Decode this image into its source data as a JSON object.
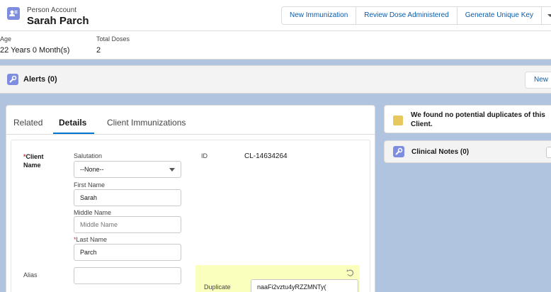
{
  "header": {
    "object_type": "Person Account",
    "record_name": "Sarah Parch",
    "actions": [
      "New Immunization",
      "Review Dose Administered",
      "Generate Unique Key"
    ],
    "more_icon": "chevron-down-icon"
  },
  "highlights": [
    {
      "label": "Age",
      "value": "22 Years 0 Month(s)"
    },
    {
      "label": "Total Doses",
      "value": "2"
    }
  ],
  "alerts": {
    "title": "Alerts (0)",
    "new_label": "New"
  },
  "tabs": [
    {
      "label": "Related",
      "active": false
    },
    {
      "label": "Details",
      "active": true
    },
    {
      "label": "Client Immunizations",
      "active": false
    }
  ],
  "details": {
    "client_name_label": "Client\nName",
    "salutation_label": "Salutation",
    "salutation_value": "--None--",
    "first_name_label": "First Name",
    "first_name_value": "Sarah",
    "middle_name_label": "Middle Name",
    "middle_name_placeholder": "Middle Name",
    "last_name_label": "Last Name",
    "last_name_value": "Parch",
    "id_label": "ID",
    "id_value": "CL-14634264",
    "alias_label": "Alias",
    "alias_value": "",
    "duplicate_label": "Duplicate",
    "duplicate_value": "naaFi2vztu4yRZZMNTy("
  },
  "side": {
    "duplicates_msg": "We found no potential duplicates of this Client.",
    "clinical_notes_title": "Clinical Notes (0)"
  },
  "colors": {
    "brand": "#0176d3",
    "link": "#0b5cab",
    "page_bg": "#b0c4df",
    "highlight": "#faffbd",
    "required": "#c23934"
  }
}
